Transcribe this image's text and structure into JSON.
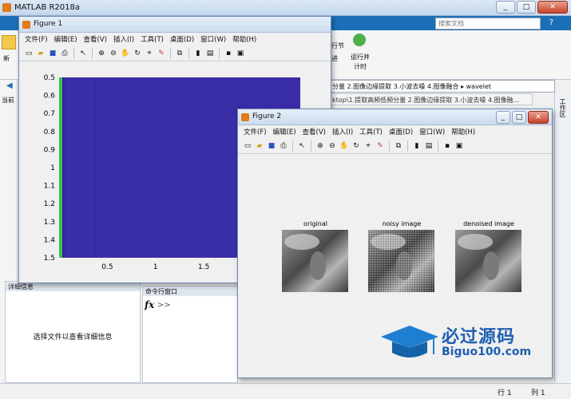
{
  "main_window": {
    "title": "MATLAB R2018a",
    "search_placeholder": "搜索文档",
    "ribbon": {
      "section_label": "行节",
      "run_advance_label": "运行并",
      "run_time_label": "计时",
      "new_label": "新",
      "left_partial": "进"
    },
    "address_bar": "分量 2.图像边缘提取 3.小波去噪 4.图像融合  ▸  wavelet",
    "path_bar": "ktop\\1.提取高频低频分量 2.图像边缘提取 3.小波去噪 4.图像融...",
    "current_folder_label": "当前",
    "workspace_label": "工作区",
    "details_header": "详细信息",
    "details_message": "选择文件以查看详细信息",
    "command_window_header": "命令行窗口",
    "fx": "fx",
    "prompt": ">>",
    "status": {
      "row_label": "行 1",
      "col_label": "列 1"
    }
  },
  "figure1": {
    "title": "Figure 1",
    "menu": [
      "文件(F)",
      "编辑(E)",
      "查看(V)",
      "插入(I)",
      "工具(T)",
      "桌面(D)",
      "窗口(W)",
      "帮助(H)"
    ],
    "toolbar_icons": [
      "new-icon",
      "open-icon",
      "save-icon",
      "print-icon",
      "pointer-icon",
      "zoom-in-icon",
      "zoom-out-icon",
      "pan-icon",
      "rotate-icon",
      "datacursor-icon",
      "brush-icon",
      "link-icon",
      "colorbar-icon",
      "legend-icon",
      "hide-plot-icon",
      "show-plot-icon"
    ]
  },
  "figure2": {
    "title": "Figure 2",
    "menu": [
      "文件(F)",
      "编辑(E)",
      "查看(V)",
      "插入(I)",
      "工具(T)",
      "桌面(D)",
      "窗口(W)",
      "帮助(H)"
    ],
    "subplots": [
      "original",
      "noisy image",
      "denoised image"
    ]
  },
  "watermark": {
    "brand": "必过源码",
    "url": "Biguo100.com"
  },
  "colors": {
    "plot_fill": "#3a2da8",
    "plot_edge_green": "#3fbf4a",
    "accent_blue": "#1b6fb6"
  },
  "chart_data": {
    "type": "heatmap",
    "title": "",
    "xlabel": "",
    "ylabel": "",
    "x_ticks": [
      "0.5",
      "1",
      "1.5"
    ],
    "y_ticks": [
      "0.5",
      "0.6",
      "0.7",
      "0.8",
      "0.9",
      "1",
      "1.1",
      "1.2",
      "1.3",
      "1.4",
      "1.5"
    ],
    "xlim": [
      0.0,
      2.5
    ],
    "ylim": [
      0.5,
      1.5
    ],
    "y_reversed": true,
    "grid": false
  }
}
